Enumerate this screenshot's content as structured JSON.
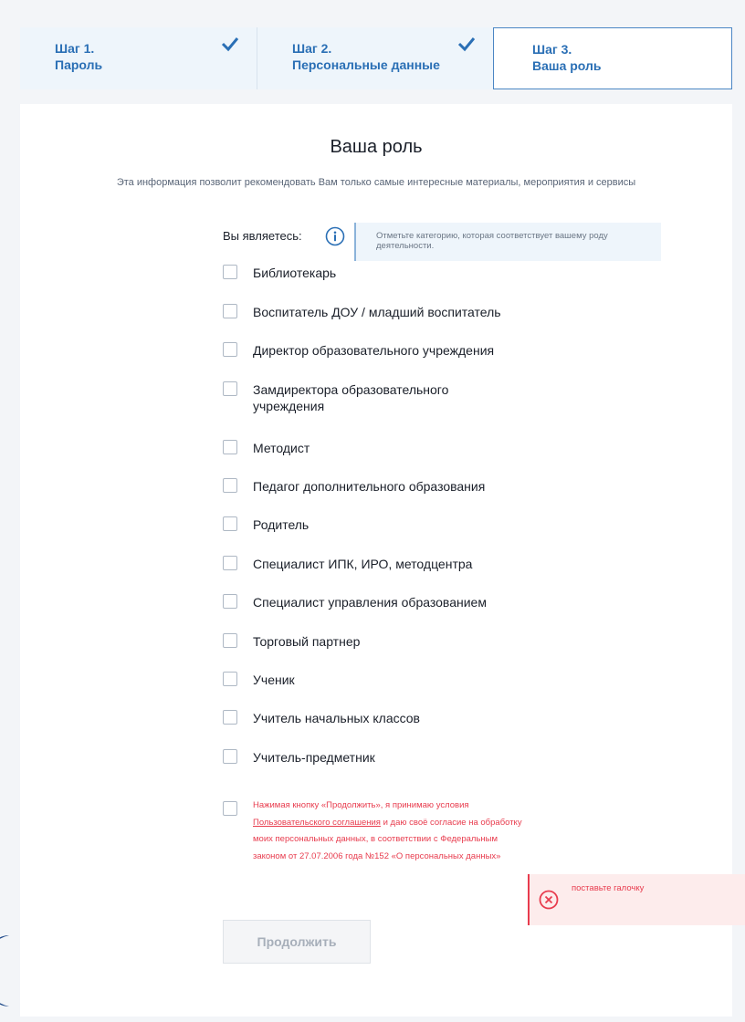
{
  "steps": [
    {
      "label": "Шаг 1.",
      "name": "Пароль",
      "done": true
    },
    {
      "label": "Шаг 2.",
      "name": "Персональные данные",
      "done": true
    },
    {
      "label": "Шаг 3.",
      "name": "Ваша роль",
      "done": false
    }
  ],
  "form": {
    "title": "Ваша роль",
    "subtitle": "Эта информация позволит рекомендовать Вам только самые интересные материалы, мероприятия и сервисы",
    "you_are_label": "Вы являетесь:",
    "hint": "Отметьте категорию, которая соответствует вашему роду деятельности.",
    "options": [
      "Библиотекарь",
      "Воспитатель ДОУ / младший воспитатель",
      "Директор образовательного учреждения",
      "Замдиректора образовательного учреждения",
      "Методист",
      "Педагог дополнительного образования",
      "Родитель",
      "Специалист ИПК, ИРО, методцентра",
      "Специалист управления образованием",
      "Торговый партнер",
      "Ученик",
      "Учитель начальных классов",
      "Учитель-предметник"
    ],
    "agreement": {
      "text_before": "Нажимая кнопку «Продолжить», я принимаю условия ",
      "link_text": "Пользовательского соглашения",
      "text_after": " и даю своё согласие на обработку моих персональных данных, в соответствии с Федеральным законом от 27.07.2006 года №152 «О персональных данных»"
    },
    "continue_label": "Продолжить"
  },
  "error": {
    "message": "поставьте галочку"
  },
  "colors": {
    "accent": "#2a6fb5",
    "error": "#e83c4e"
  }
}
